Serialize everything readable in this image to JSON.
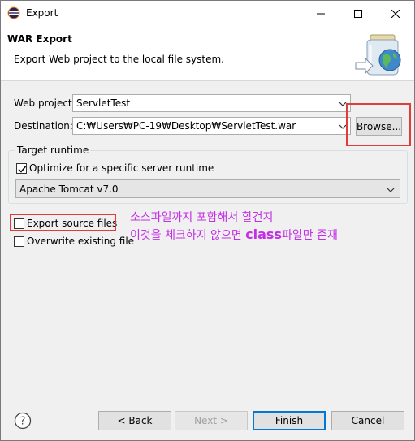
{
  "window": {
    "title": "Export",
    "icon": "eclipse-icon",
    "controls": {
      "minimize": "minimize-icon",
      "maximize": "maximize-icon",
      "close": "close-icon"
    }
  },
  "header": {
    "title": "WAR Export",
    "description": "Export Web project to the local file system."
  },
  "form": {
    "web_project_label": "Web project:",
    "web_project_value": "ServletTest",
    "destination_label": "Destination:",
    "destination_value": "C:₩Users₩PC-19₩Desktop₩ServletTest.war",
    "browse_label": "Browse..."
  },
  "target_runtime": {
    "group_title": "Target runtime",
    "optimize_label": "Optimize for a specific server runtime",
    "optimize_checked": true,
    "runtime_value": "Apache Tomcat v7.0"
  },
  "options": {
    "export_source_label": "Export source files",
    "export_source_checked": false,
    "overwrite_label": "Overwrite existing file",
    "overwrite_checked": false
  },
  "annotation": {
    "line1": "소스파일까지 포함해서 할건지",
    "line2_prefix": "이것을 체크하지 않으면 ",
    "line2_bold": "class",
    "line2_suffix": "파일만 존재",
    "color": "#c42fe6",
    "highlight_color": "#e03c3c"
  },
  "footer": {
    "back_label": "< Back",
    "next_label": "Next >",
    "finish_label": "Finish",
    "cancel_label": "Cancel"
  }
}
